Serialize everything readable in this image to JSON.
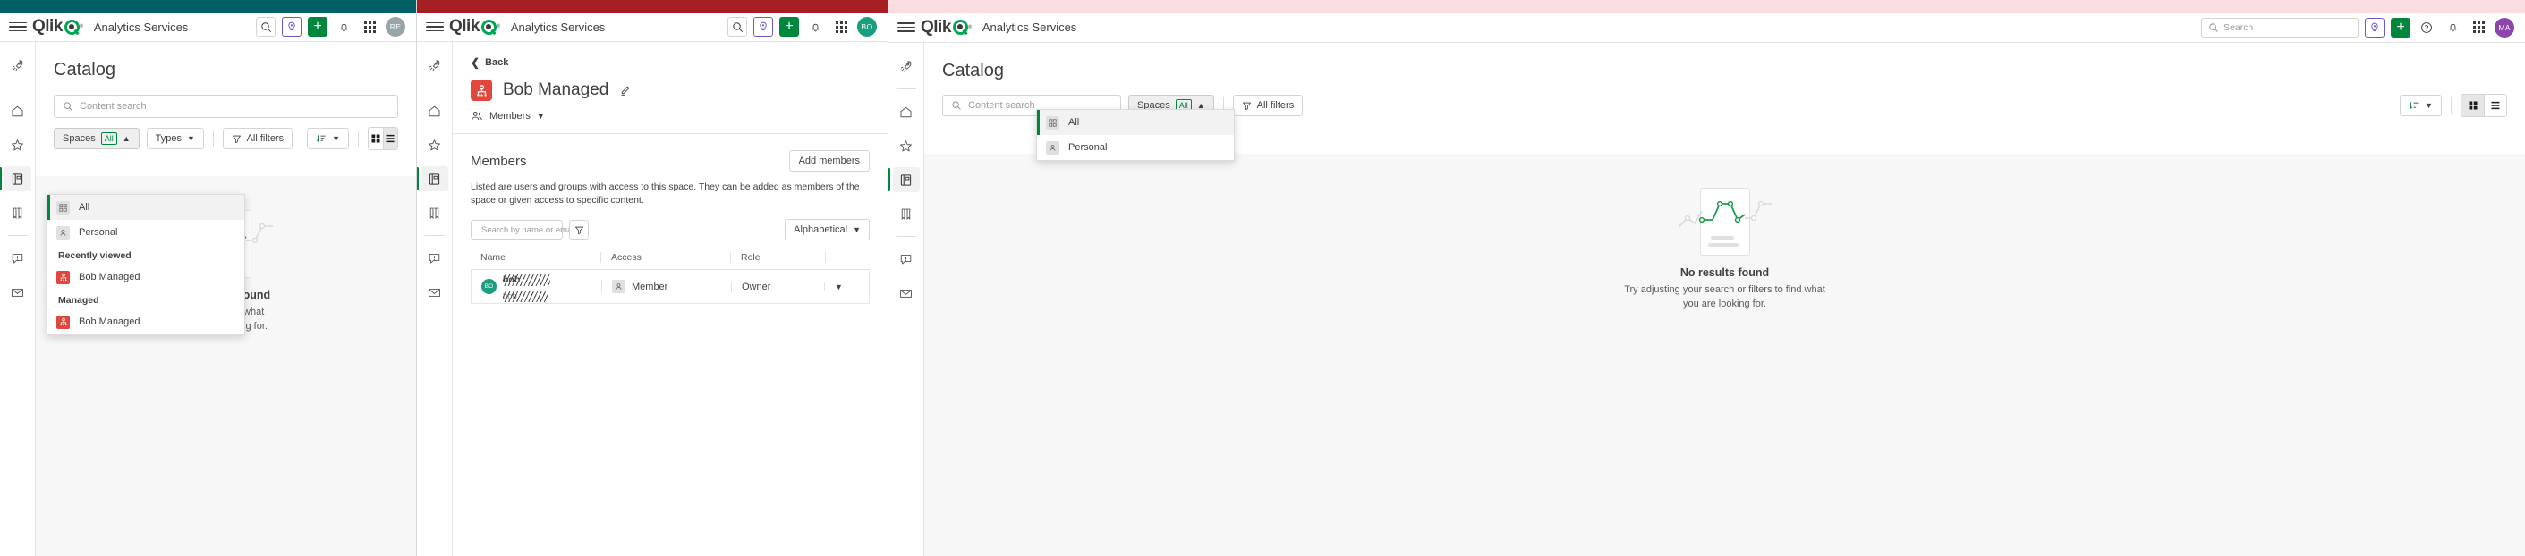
{
  "panels": [
    {
      "accent_color": "#005f64",
      "topnav": {
        "product": "Qlik",
        "tenant": "Analytics Services",
        "avatar_initials": "RE",
        "avatar_color": "#98a5a8",
        "icons": [
          "search-icon",
          "insight-advisor-icon",
          "create-icon",
          "notifications-icon",
          "app-launcher-icon"
        ]
      },
      "page_title": "Catalog",
      "content_search_placeholder": "Content search",
      "filters": {
        "spaces_label": "Spaces",
        "spaces_badge": "All",
        "types_label": "Types",
        "all_filters_label": "All filters"
      },
      "view_mode": "list",
      "spaces_dropdown": {
        "open": true,
        "items": [
          {
            "label": "All",
            "icon": "grid-icon",
            "selected": true
          },
          {
            "label": "Personal",
            "icon": "person-icon",
            "selected": false
          }
        ],
        "groups": [
          {
            "header": "Recently viewed",
            "items": [
              {
                "label": "Bob Managed",
                "icon": "managed-space-icon"
              }
            ]
          },
          {
            "header": "Managed",
            "items": [
              {
                "label": "Bob Managed",
                "icon": "managed-space-icon"
              }
            ]
          }
        ]
      },
      "empty_state": {
        "title": "No results found",
        "line1": "filters to find what",
        "line2": "you are looking for."
      }
    },
    {
      "accent_color": "#a61f23",
      "topnav": {
        "product": "Qlik",
        "tenant": "Analytics Services",
        "avatar_initials": "BO",
        "avatar_color": "#1a9e7f"
      },
      "back_label": "Back",
      "space": {
        "name": "Bob Managed",
        "icon": "managed-space-icon",
        "edit_icon": "pencil-icon"
      },
      "tabs": [
        {
          "label": "Members",
          "icon": "members-icon"
        }
      ],
      "members": {
        "heading": "Members",
        "add_button": "Add members",
        "description": "Listed are users and groups with access to this space. They can be added as members of the space or given access to specific content.",
        "search_placeholder": "Search by name or email",
        "sort_label": "Alphabetical",
        "columns": [
          "Name",
          "Access",
          "Role",
          ""
        ],
        "rows": [
          {
            "avatar_initials": "BO",
            "name": "bob",
            "email": "bob",
            "redacted": true,
            "access": "Member",
            "access_icon": "person-icon",
            "role": "Owner"
          }
        ]
      }
    },
    {
      "accent_color": "#fadde0",
      "topnav": {
        "product": "Qlik",
        "tenant": "Analytics Services",
        "search_placeholder": "Search",
        "avatar_initials": "MA",
        "avatar_color": "#8e44ad",
        "icons": [
          "insight-advisor-icon",
          "create-icon",
          "help-icon",
          "notifications-icon",
          "app-launcher-icon"
        ]
      },
      "page_title": "Catalog",
      "content_search_placeholder": "Content search",
      "filters": {
        "spaces_label": "Spaces",
        "spaces_badge": "All",
        "all_filters_label": "All filters"
      },
      "view_mode": "grid",
      "spaces_dropdown": {
        "open": true,
        "items": [
          {
            "label": "All",
            "icon": "grid-icon",
            "selected": true
          },
          {
            "label": "Personal",
            "icon": "person-icon",
            "selected": false
          }
        ]
      },
      "empty_state": {
        "title": "No results found",
        "line1": "Try adjusting your search or filters to find what",
        "line2": "you are looking for."
      }
    }
  ],
  "rail_icons": [
    "rocket-icon",
    "home-icon",
    "favorites-icon",
    "catalog-icon",
    "bookmarks-icon",
    "alerts-icon",
    "subscriptions-icon"
  ]
}
